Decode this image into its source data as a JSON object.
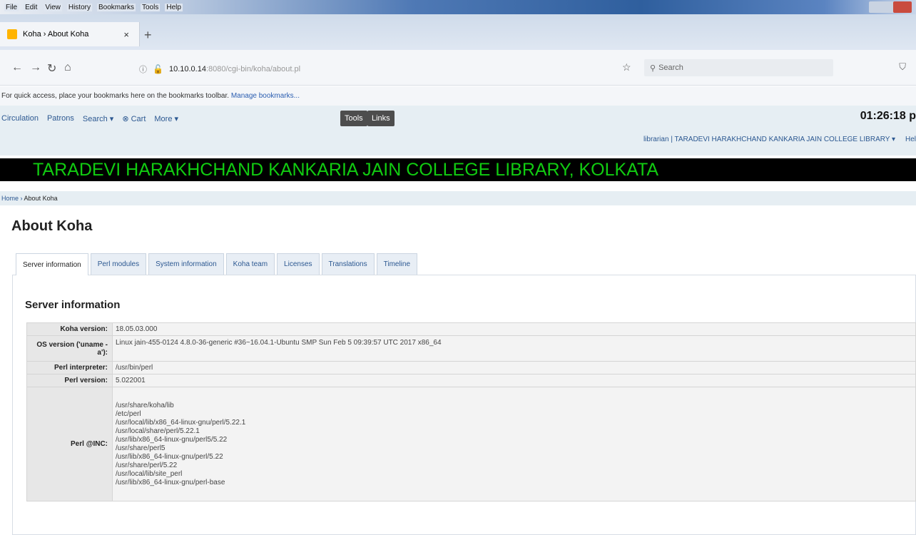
{
  "browser": {
    "menu": [
      "File",
      "Edit",
      "View",
      "History",
      "Bookmarks",
      "Tools",
      "Help"
    ],
    "tab_title": "Koha › About Koha",
    "url_host": "10.10.0.14",
    "url_path": ":8080/cgi-bin/koha/about.pl",
    "search_placeholder": "Search",
    "bookmarks_hint": "For quick access, place your bookmarks here on the bookmarks toolbar.",
    "bookmarks_link": "Manage bookmarks..."
  },
  "koha": {
    "menu": [
      "Circulation",
      "Patrons",
      "Search ▾",
      "⊗ Cart",
      "More ▾"
    ],
    "tools_button": "Tools",
    "links_button": "Links",
    "clock": "01:26:18 p",
    "user_role": "librarian",
    "library_name": "TARADEVI HARAKHCHAND KANKARIA JAIN COLLEGE LIBRARY ▾",
    "help_label": "Hel",
    "banner": "TARADEVI HARAKHCHAND KANKARIA JAIN COLLEGE LIBRARY, KOLKATA",
    "breadcrumb_home": "Home",
    "breadcrumb_sep": "›",
    "breadcrumb_current": "About Koha",
    "page_title": "About Koha",
    "tabs": [
      "Server information",
      "Perl modules",
      "System information",
      "Koha team",
      "Licenses",
      "Translations",
      "Timeline"
    ],
    "section_title": "Server information",
    "info": {
      "koha_version_label": "Koha version:",
      "koha_version": "18.05.03.000",
      "os_label": "OS version ('uname -a'):",
      "os_value": "Linux jain-455-0124 4.8.0-36-generic #36~16.04.1-Ubuntu SMP Sun Feb 5 09:39:57 UTC 2017 x86_64",
      "perl_interp_label": "Perl interpreter:",
      "perl_interp": "/usr/bin/perl",
      "perl_version_label": "Perl version:",
      "perl_version": "5.022001",
      "perl_inc_label": "Perl @INC:",
      "perl_inc": [
        "/usr/share/koha/lib",
        "/etc/perl",
        "/usr/local/lib/x86_64-linux-gnu/perl/5.22.1",
        "/usr/local/share/perl/5.22.1",
        "/usr/lib/x86_64-linux-gnu/perl5/5.22",
        "/usr/share/perl5",
        "/usr/lib/x86_64-linux-gnu/perl/5.22",
        "/usr/share/perl/5.22",
        "/usr/local/lib/site_perl",
        "/usr/lib/x86_64-linux-gnu/perl-base"
      ]
    }
  }
}
